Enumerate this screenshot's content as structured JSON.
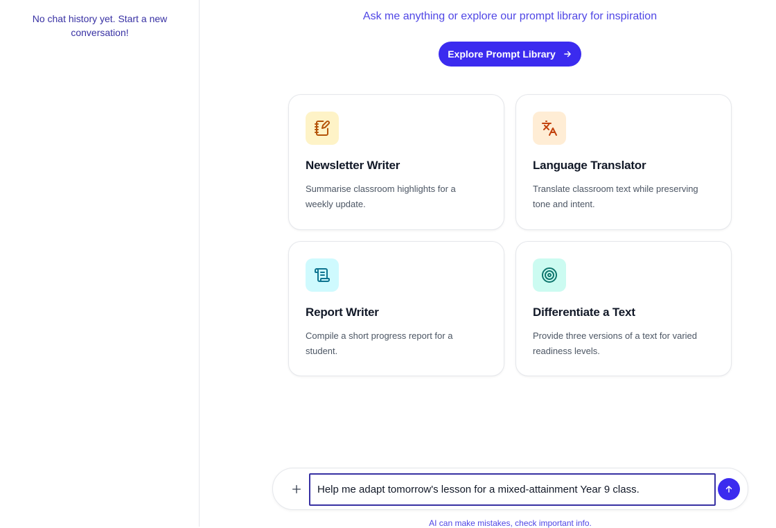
{
  "sidebar": {
    "empty_message": "No chat history yet. Start a new conversation!"
  },
  "hero": {
    "subtitle": "Ask me anything or explore our prompt library for inspiration",
    "explore_label": "Explore Prompt Library"
  },
  "cards": [
    {
      "title": "Newsletter Writer",
      "description": "Summarise classroom highlights for a weekly update.",
      "icon": "notebook-pen-icon",
      "icon_bg": "#fef3c7",
      "icon_color": "#b45309"
    },
    {
      "title": "Language Translator",
      "description": "Translate classroom text while preserving tone and intent.",
      "icon": "languages-icon",
      "icon_bg": "#ffedd5",
      "icon_color": "#c2410c"
    },
    {
      "title": "Report Writer",
      "description": "Compile a short progress report for a student.",
      "icon": "scroll-text-icon",
      "icon_bg": "#cffafe",
      "icon_color": "#0e7490"
    },
    {
      "title": "Differentiate a Text",
      "description": "Provide three versions of a text for varied readiness levels.",
      "icon": "target-icon",
      "icon_bg": "#ccfbf1",
      "icon_color": "#0f766e"
    }
  ],
  "composer": {
    "input_value": "Help me adapt tomorrow's lesson for a mixed-attainment Year 9 class.",
    "disclaimer": "AI can make mistakes, check important info."
  },
  "colors": {
    "accent": "#3b2bef",
    "accent_text": "#4f46e5"
  }
}
